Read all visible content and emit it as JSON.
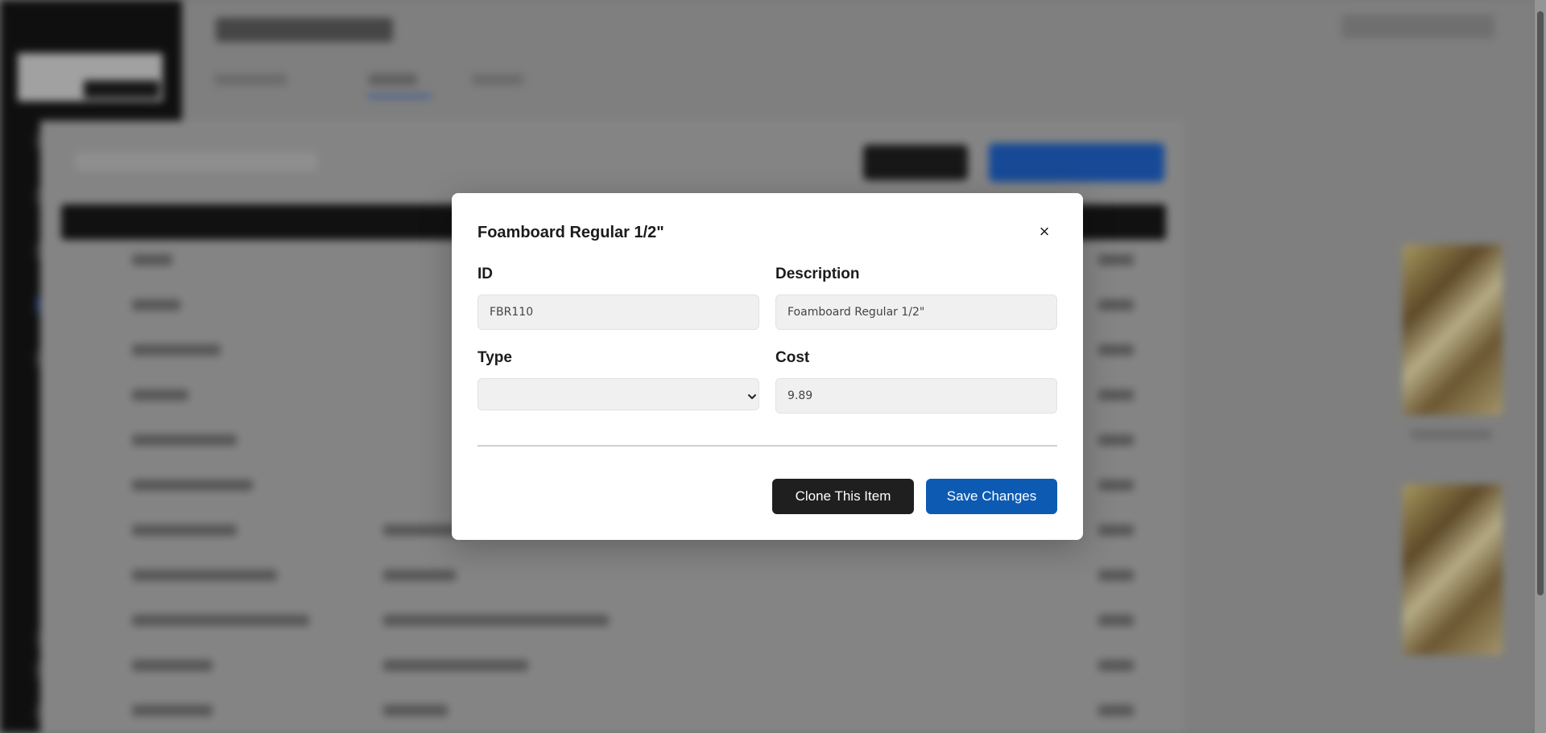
{
  "modal": {
    "title": "Foamboard Regular 1/2\"",
    "close_symbol": "×",
    "fields": {
      "id_label": "ID",
      "id_value": "FBR110",
      "description_label": "Description",
      "description_value": "Foamboard Regular 1/2\"",
      "type_label": "Type",
      "type_value": "",
      "cost_label": "Cost",
      "cost_value": "9.89"
    },
    "buttons": {
      "clone_label": "Clone This Item",
      "save_label": "Save Changes"
    }
  },
  "colors": {
    "save_button": "#0d5ab3",
    "clone_button": "#1f1f1f",
    "sidebar": "#141414",
    "accent": "#2d63c8"
  },
  "icons": {
    "close": "close-icon",
    "select": "chevron-down-icon"
  }
}
